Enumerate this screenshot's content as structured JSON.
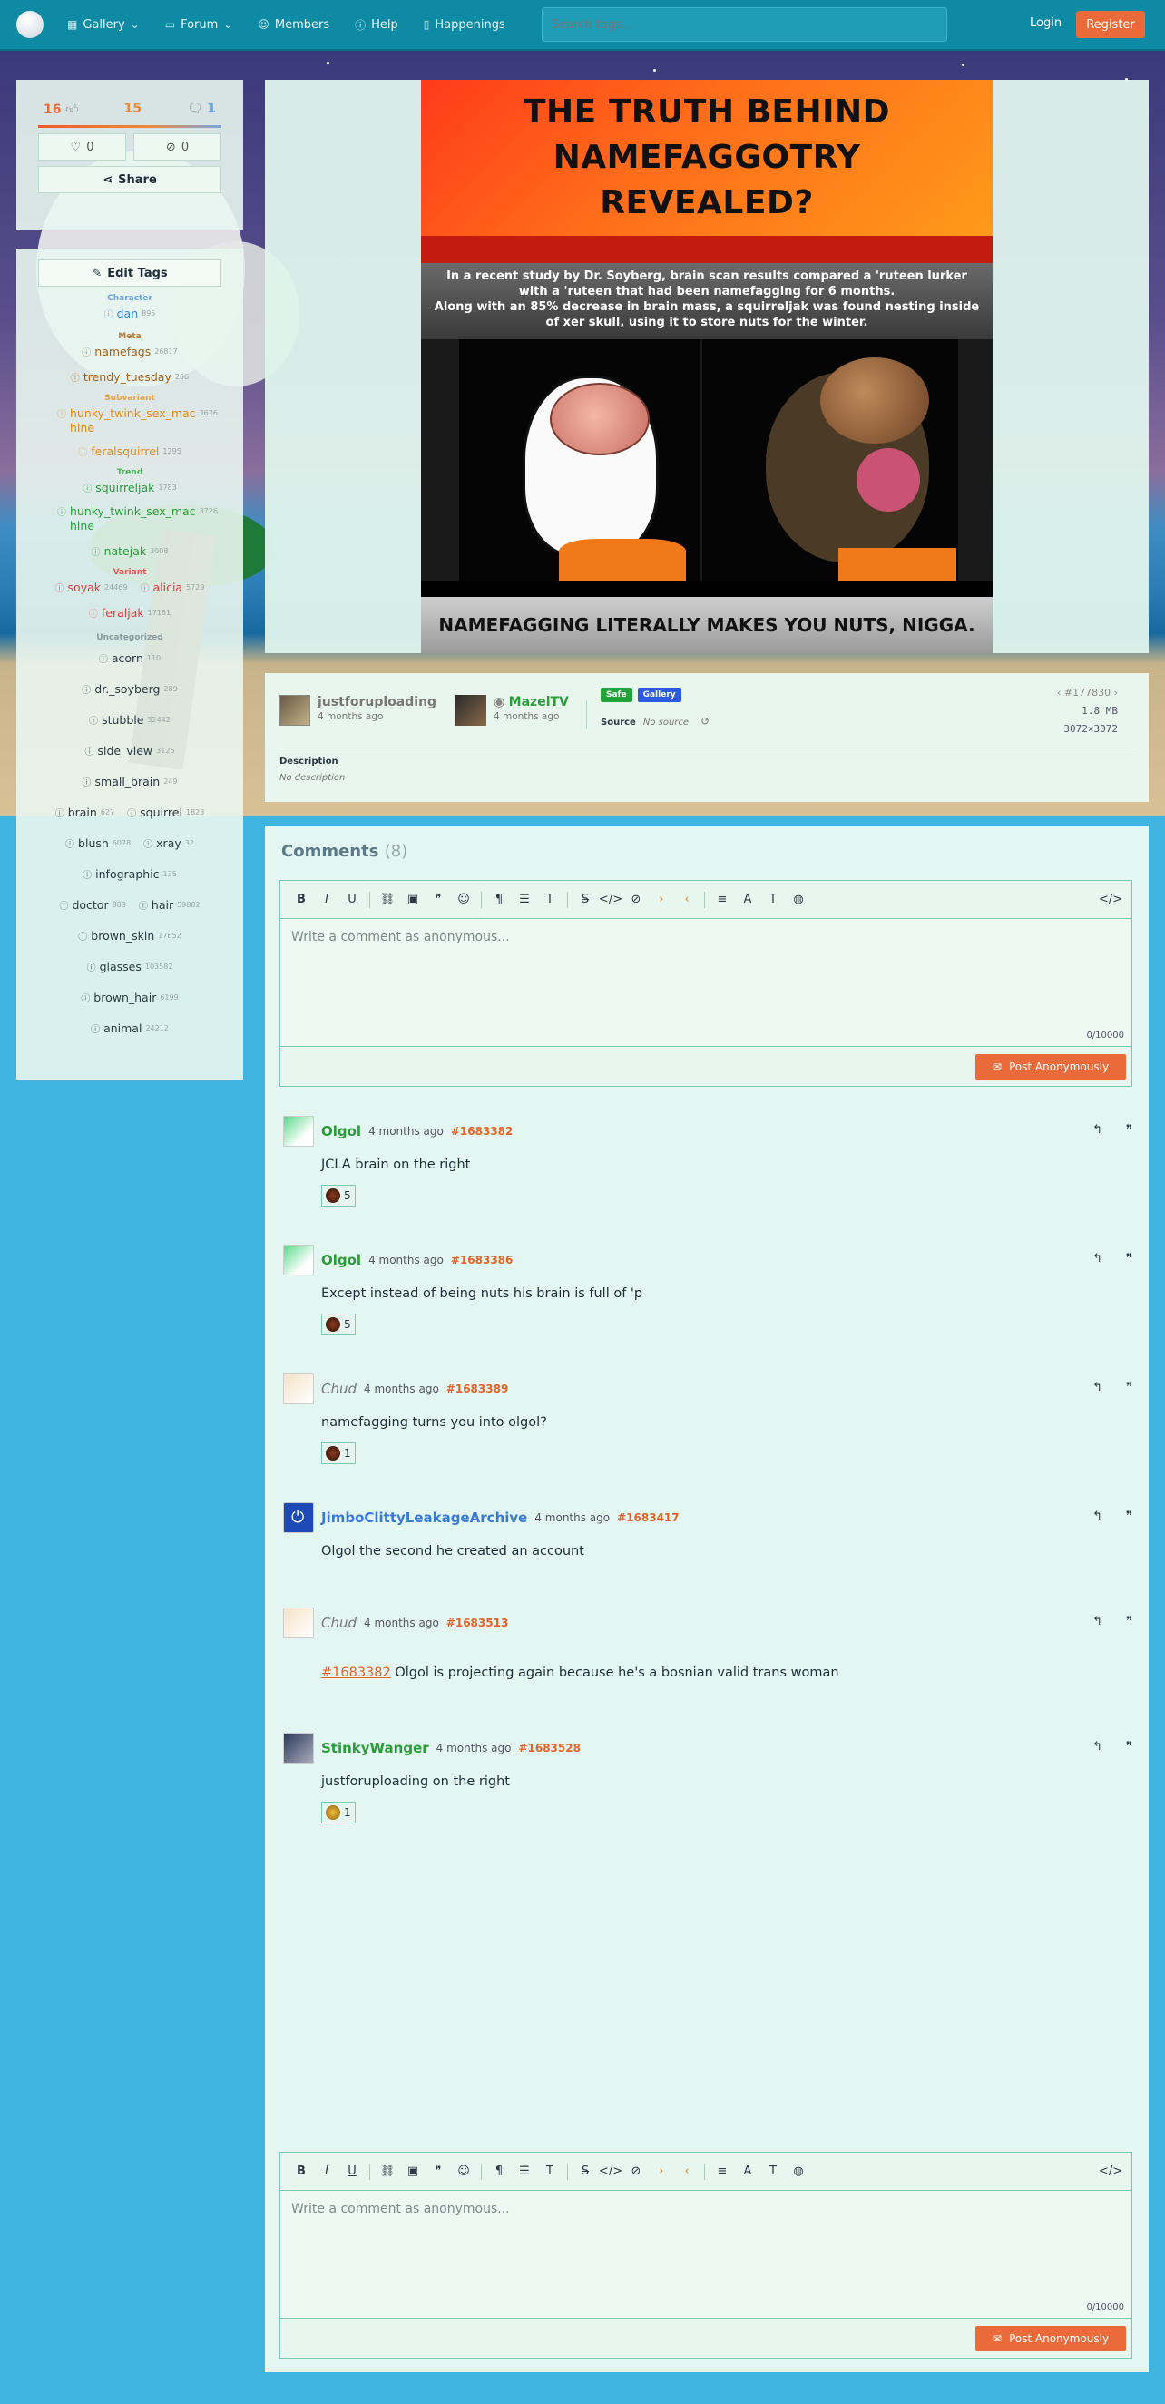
{
  "nav": {
    "gallery": "Gallery",
    "forum": "Forum",
    "members": "Members",
    "help": "Help",
    "happenings": "Happenings",
    "search_placeholder": "Search tags...",
    "login": "Login",
    "register": "Register"
  },
  "stats": {
    "upvotes": "16",
    "favorites": "15",
    "comments": "1",
    "likes": "0",
    "hidden": "0",
    "share": "Share"
  },
  "tags": {
    "edit_label": "Edit Tags",
    "categories": {
      "character": "Character",
      "meta": "Meta",
      "subvariant": "Subvariant",
      "trend": "Trend",
      "variant": "Variant",
      "uncategorized": "Uncategorized"
    },
    "character": [
      {
        "name": "dan",
        "count": "895"
      }
    ],
    "meta": [
      {
        "name": "namefags",
        "count": "26817"
      },
      {
        "name": "trendy_tuesday",
        "count": "266"
      }
    ],
    "subvariant": [
      {
        "name": "hunky_twink_sex_mac hine",
        "count": "3626"
      },
      {
        "name": "feralsquirrel",
        "count": "1295"
      }
    ],
    "trend": [
      {
        "name": "squirreljak",
        "count": "1783"
      },
      {
        "name": "hunky_twink_sex_mac hine",
        "count": "3726"
      },
      {
        "name": "natejak",
        "count": "3008"
      }
    ],
    "variant": [
      {
        "name": "soyak",
        "count": "24469"
      },
      {
        "name": "alicia",
        "count": "5729"
      },
      {
        "name": "feraljak",
        "count": "17181"
      }
    ],
    "uncategorized": [
      {
        "name": "acorn",
        "count": "110"
      },
      {
        "name": "dr._soyberg",
        "count": "289"
      },
      {
        "name": "stubble",
        "count": "32442"
      },
      {
        "name": "side_view",
        "count": "3126"
      },
      {
        "name": "small_brain",
        "count": "249"
      },
      {
        "name": "brain",
        "count": "627"
      },
      {
        "name": "squirrel",
        "count": "1823"
      },
      {
        "name": "blush",
        "count": "6078"
      },
      {
        "name": "xray",
        "count": "32"
      },
      {
        "name": "infographic",
        "count": "135"
      },
      {
        "name": "doctor",
        "count": "888"
      },
      {
        "name": "hair",
        "count": "59882"
      },
      {
        "name": "brown_skin",
        "count": "17652"
      },
      {
        "name": "glasses",
        "count": "103582"
      },
      {
        "name": "brown_hair",
        "count": "6199"
      },
      {
        "name": "animal",
        "count": "24212"
      }
    ]
  },
  "meme": {
    "title": "THE TRUTH BEHIND NAMEFAGGOTRY REVEALED?",
    "text_line1": "In a recent study by Dr. Soyberg, brain scan results compared a 'ruteen lurker with a 'ruteen that had been namefagging for 6 months.",
    "text_line2": "Along with an 85% decrease in brain mass, a squirreljak was found nesting inside of xer skull, using it to store nuts for the winter.",
    "bottom": "NAMEFAGGING LITERALLY MAKES YOU NUTS, NIGGA."
  },
  "post": {
    "uploader": "justforuploading",
    "uploader_time": "4 months ago",
    "approver": "MazelTV",
    "approver_time": "4 months ago",
    "badge_safe": "Safe",
    "badge_gallery": "Gallery",
    "source_label": "Source",
    "source_value": "No source",
    "post_id": "#177830",
    "filesize": "1.8 MB",
    "dimensions": "3072×3072",
    "description_label": "Description",
    "description_value": "No description"
  },
  "comments": {
    "title": "Comments",
    "count": "(8)",
    "placeholder": "Write a comment as anonymous...",
    "counter": "0/10000",
    "post_button": "Post Anonymously",
    "items": [
      {
        "author": "Olgol",
        "time": "4 months ago",
        "id": "#1683382",
        "body": "JCLA brain on the right",
        "reactions": "5"
      },
      {
        "author": "Olgol",
        "time": "4 months ago",
        "id": "#1683386",
        "body": "Except instead of being nuts his brain is full of 'p",
        "reactions": "5"
      },
      {
        "author": "Chud",
        "time": "4 months ago",
        "id": "#1683389",
        "body": "namefagging turns you into olgol?",
        "reactions": "1"
      },
      {
        "author": "JimboClittyLeakageArchive",
        "time": "4 months ago",
        "id": "#1683417",
        "body": "Olgol the second he created an account",
        "reactions": ""
      },
      {
        "author": "Chud",
        "time": "4 months ago",
        "id": "#1683513",
        "ref": "#1683382",
        "body": " Olgol is projecting again because he's a bosnian valid trans woman",
        "reactions": ""
      },
      {
        "author": "StinkyWanger",
        "time": "4 months ago",
        "id": "#1683528",
        "body": "justforuploading on the right",
        "reactions": "1"
      }
    ]
  },
  "colors": {
    "topbar": "#0e8aa4",
    "accent": "#ea6a3a",
    "background": "#3fb4e0"
  }
}
